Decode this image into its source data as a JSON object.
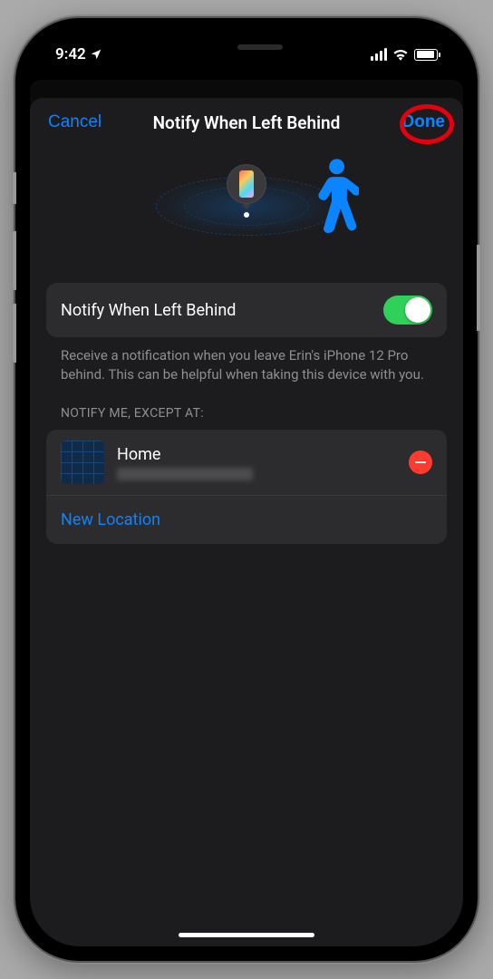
{
  "status": {
    "time": "9:42",
    "location_icon": "location-arrow"
  },
  "header": {
    "cancel": "Cancel",
    "title": "Notify When Left Behind",
    "done": "Done"
  },
  "toggle": {
    "label": "Notify When Left Behind",
    "on": true
  },
  "description": "Receive a notification when you leave Erin's iPhone 12 Pro behind. This can be helpful when taking this device with you.",
  "section_header": "NOTIFY ME, EXCEPT AT:",
  "locations": [
    {
      "name": "Home",
      "address": "redacted"
    }
  ],
  "new_location": "New Location",
  "colors": {
    "accent": "#0a84ff",
    "green": "#30d158",
    "red": "#ff3b30"
  }
}
